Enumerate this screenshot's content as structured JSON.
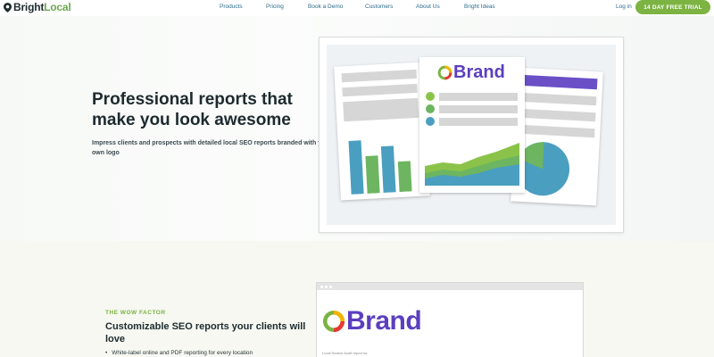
{
  "nav": {
    "logo_bright": "Bright",
    "logo_local": "Local",
    "links": [
      "Products",
      "Pricing",
      "Book a Demo",
      "Customers",
      "About Us",
      "Bright Ideas"
    ],
    "login": "Log in",
    "trial": "14 DAY FREE TRIAL"
  },
  "hero": {
    "title": "Professional reports that make you look awesome",
    "subtitle": "Impress clients and prospects with detailed local SEO reports branded with your own logo",
    "brand_word": "Brand"
  },
  "section2": {
    "eyebrow": "THE WOW FACTOR",
    "title": "Customizable SEO reports your clients will love",
    "bullet": "White-label online and PDF reporting for every location",
    "brand_word": "Brand",
    "report_caption": "Local Search Audit report for"
  },
  "colors": {
    "accent_green": "#7cb342",
    "brand_purple": "#5b3fbf",
    "chart_blue": "#4a9fc0",
    "nav_link": "#2e6b8a"
  }
}
